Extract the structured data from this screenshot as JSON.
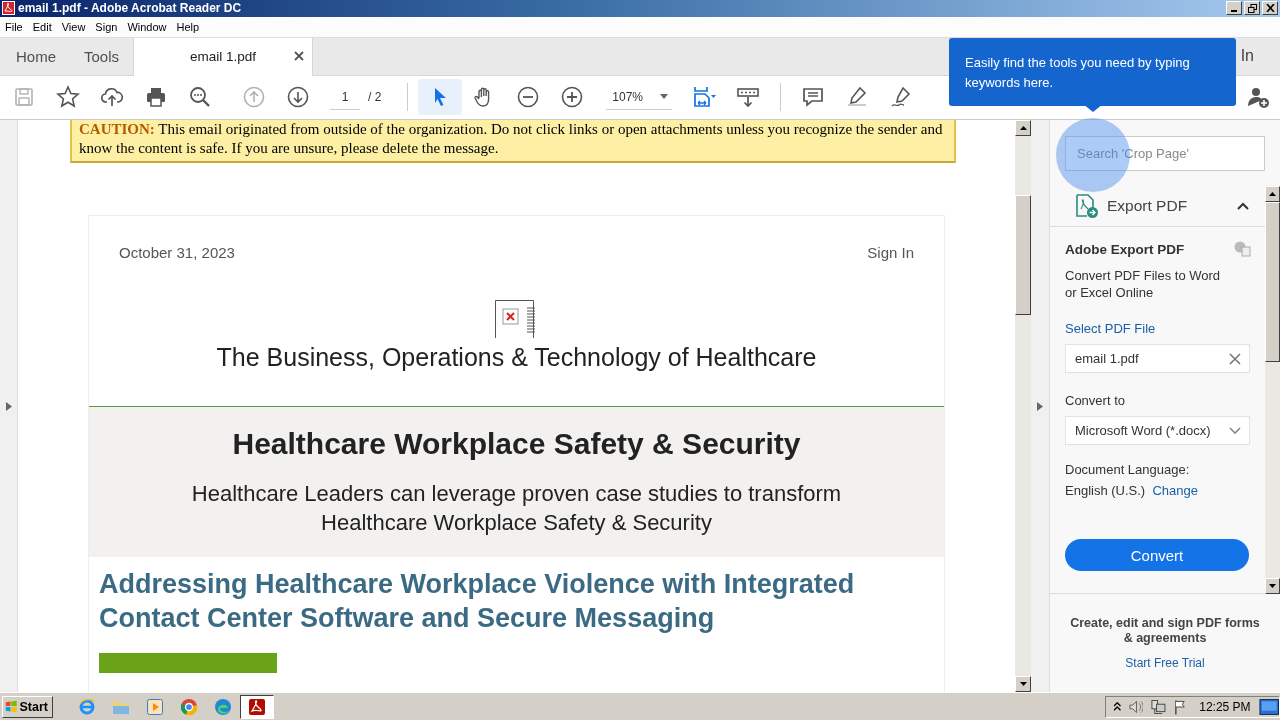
{
  "window": {
    "title": "email 1.pdf - Adobe Acrobat Reader DC"
  },
  "menu": [
    "File",
    "Edit",
    "View",
    "Sign",
    "Window",
    "Help"
  ],
  "tabs": [
    {
      "label": "Home",
      "selected": false
    },
    {
      "label": "Tools",
      "selected": false
    },
    {
      "label": "email 1.pdf",
      "selected": true,
      "closable": true
    }
  ],
  "sign_in": "In",
  "toolbar": {
    "items": [
      {
        "kind": "save",
        "disabled": true
      },
      {
        "kind": "star",
        "disabled": false
      },
      {
        "kind": "upload",
        "disabled": false
      },
      {
        "kind": "print",
        "disabled": false
      },
      {
        "kind": "find",
        "disabled": false
      },
      {
        "kind": "page-up",
        "disabled": true
      },
      {
        "kind": "page-down",
        "disabled": false
      }
    ],
    "page": "1",
    "page_total": "/ 2",
    "tools": [
      {
        "kind": "select",
        "selected": true
      },
      {
        "kind": "hand",
        "selected": false
      }
    ],
    "zoom_buttons": [
      {
        "kind": "zoom-out"
      },
      {
        "kind": "zoom-in"
      }
    ],
    "zoom": "107%",
    "view_buttons": [
      {
        "kind": "fit-page"
      },
      {
        "kind": "scroll-mode"
      }
    ],
    "edit_buttons": [
      {
        "kind": "comment"
      },
      {
        "kind": "highlight"
      },
      {
        "kind": "sign"
      }
    ],
    "end_buttons": [
      {
        "kind": "add-person"
      }
    ]
  },
  "tooltip": "Easily find the tools you need by typing keywords here.",
  "document": {
    "caution": "**CAUTION:** This email originated from outside of the organization. Do not click links or open attachments unless you recognize the sender and know the content is safe. If you are unsure, please delete the message.",
    "date": "October 31, 2023",
    "sign_in": "Sign In",
    "tagline": "The Business, Operations & Technology of Healthcare",
    "hero_title": "Healthcare Workplace Safety & Security",
    "hero_subtitle": "Healthcare Leaders can leverage proven case studies to transform Healthcare Workplace Safety & Security",
    "article_title": "Addressing Healthcare Workplace Violence with Integrated Contact Center Software and Secure Messaging"
  },
  "tools_pane": {
    "search": {
      "placeholder": "Search 'Crop Page'"
    },
    "tool": {
      "name": "Export PDF",
      "expanded": true
    },
    "title": "Adobe Export PDF",
    "description": "Convert PDF Files to Word or Excel Online",
    "select_label": "Select PDF File",
    "file": "email 1.pdf",
    "convert_to_label": "Convert to",
    "format": "Microsoft Word (*.docx)",
    "language_label": "Document Language:",
    "language": "English (U.S.)",
    "change": "Change",
    "convert": "Convert",
    "promo": "Create, edit and sign PDF forms & agreements",
    "trial": "Start Free Trial"
  },
  "taskbar": {
    "start": "Start",
    "apps": [
      {
        "kind": "ie",
        "active": false
      },
      {
        "kind": "folder",
        "active": false
      },
      {
        "kind": "media",
        "active": false
      },
      {
        "kind": "chrome",
        "active": false
      },
      {
        "kind": "edge",
        "active": false
      },
      {
        "kind": "acrobat",
        "active": true
      }
    ],
    "clock": "12:25 PM"
  }
}
